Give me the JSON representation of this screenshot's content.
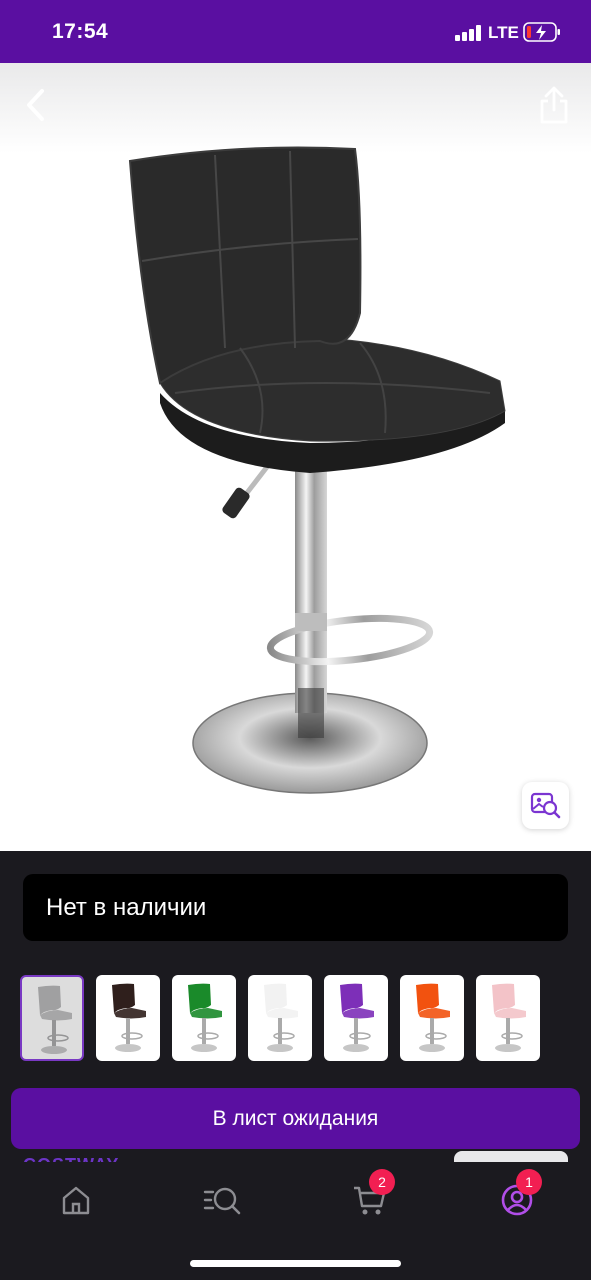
{
  "status_bar": {
    "time": "17:54",
    "network": "LTE"
  },
  "product": {
    "availability": "Нет в наличии",
    "color_options": [
      {
        "name": "grey-chair",
        "seat": "#b8b8b8",
        "selected": true
      },
      {
        "name": "brown-chair",
        "seat": "#2f1f1c",
        "selected": false
      },
      {
        "name": "green-chair",
        "seat": "#1a8a2a",
        "selected": false
      },
      {
        "name": "white-chair",
        "seat": "#f2f2f2",
        "selected": false
      },
      {
        "name": "purple-chair",
        "seat": "#7d2fb8",
        "selected": false
      },
      {
        "name": "orange-chair",
        "seat": "#f2520f",
        "selected": false
      },
      {
        "name": "pink-chair",
        "seat": "#f3c3c8",
        "selected": false
      }
    ],
    "main_image_color": "#2a2a2a"
  },
  "actions": {
    "waitlist_label": "В лист ожидания"
  },
  "brand_peek": "COSTWAY ›",
  "bottom_nav": {
    "items": [
      {
        "name": "home-icon"
      },
      {
        "name": "catalog-search-icon"
      },
      {
        "name": "cart-icon",
        "badge": "2"
      },
      {
        "name": "profile-icon",
        "badge": "1"
      }
    ]
  },
  "colors": {
    "accent": "#5a0fa1",
    "badge": "#f21f52",
    "background": "#1b1a1f"
  }
}
